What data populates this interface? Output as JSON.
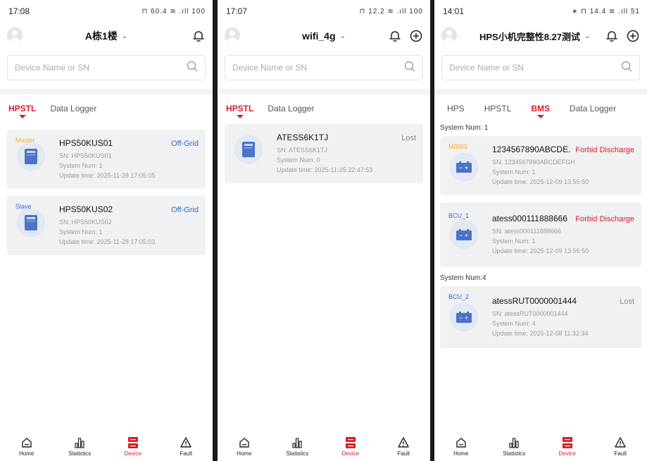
{
  "search_placeholder": "Device Name or SN",
  "nav": {
    "home": "Home",
    "statistics": "Statistics",
    "device": "Device",
    "fault": "Fault"
  },
  "screens": [
    {
      "status_time": "17:08",
      "status_right": "⊓ 60.4 ≋ .ıll 100",
      "site_title": "A栋1楼",
      "tabs": [
        "HPSTL",
        "Data Logger"
      ],
      "devices": [
        {
          "role": "Master",
          "name": "HPS50KUS01",
          "status": "Off-Grid",
          "sn": "SN: HPS50KUS01",
          "system_num": "System Num: 1",
          "update": "Update time: 2025-11-28 17:05:05"
        },
        {
          "role": "Slave",
          "name": "HPS50KUS02",
          "status": "Off-Grid",
          "sn": "SN: HPS50KUS02",
          "system_num": "System Num: 1",
          "update": "Update time: 2025-11-28 17:05:03"
        }
      ]
    },
    {
      "status_time": "17:07",
      "status_right": "⊓ 12.2 ≋ .ıll 100",
      "site_title": "wifi_4g",
      "tabs": [
        "HPSTL",
        "Data Logger"
      ],
      "devices": [
        {
          "name": "ATESS6K1TJ",
          "status": "Lost",
          "sn": "SN: ATESS6K1TJ",
          "system_num": "System Num: 0",
          "update": "Update time: 2025-11-25 22:47:53"
        }
      ]
    },
    {
      "status_time": "14:01",
      "status_right": "∗ ⊓ 14.4 ≋ .ıll 51",
      "site_title": "HPS小机完整性8.27测试",
      "tabs": [
        "HPS",
        "HPSTL",
        "BMS",
        "Data Logger"
      ],
      "groups": [
        {
          "label": "System Num: 1",
          "devices": [
            {
              "role": "MBMS",
              "name": "1234567890ABCDE...",
              "status": "Forbid Discharge",
              "sn": "SN: 1234567890ABCDEFGH",
              "system_num": "System Num: 1",
              "update": "Update time: 2025-12-09 13:55:50"
            },
            {
              "role": "BCU_1",
              "name": "atess000111888666",
              "status": "Forbid Discharge",
              "sn": "SN: atess000111888666",
              "system_num": "System Num: 1",
              "update": "Update time: 2025-12-09 13:55:50"
            }
          ]
        },
        {
          "label": "System Num:4",
          "devices": [
            {
              "role": "BCU_2",
              "name": "atessRUT0000001444",
              "status": "Lost",
              "sn": "SN: atessRUT0000001444",
              "system_num": "System Num: 4",
              "update": "Update time: 2025-12-08 11:32:34"
            }
          ]
        }
      ]
    }
  ],
  "colors": {
    "accent": "#d81e28",
    "link_blue": "#2e6ad1",
    "card_bg": "#f0f1f3"
  },
  "icons": [
    "avatar-icon",
    "bell-icon",
    "plus-circle-icon",
    "search-icon",
    "inverter-icon",
    "battery-icon",
    "home-icon",
    "statistics-icon",
    "device-icon",
    "fault-icon"
  ]
}
